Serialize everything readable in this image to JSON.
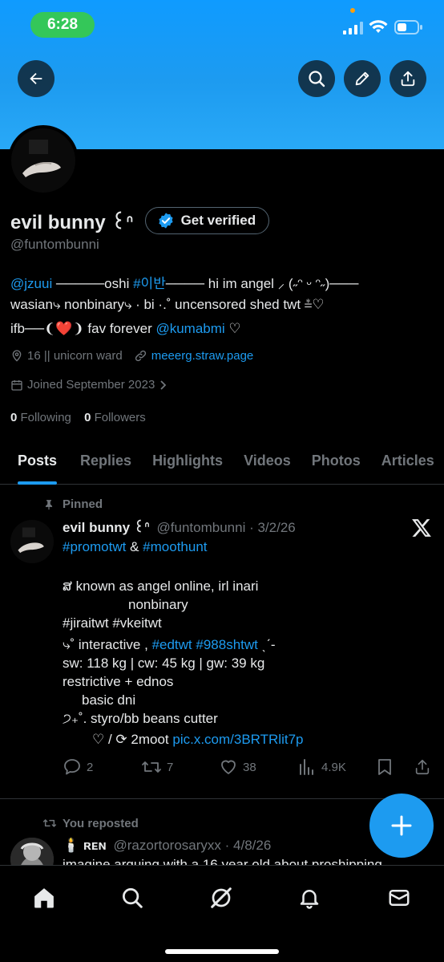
{
  "status_bar": {
    "time": "6:28"
  },
  "profile": {
    "display_name": "evil bunny ૮⁀⁀⁀",
    "display_name_short": "evil bunny ꒰ᐢ",
    "get_verified": "Get verified",
    "handle": "@funtombunni",
    "bio": {
      "line1": {
        "mention1": "@jzuui",
        "t1": " ─────oshi ",
        "hashtag": "#이반",
        "t2": "──── hi im angel ⸝ (˶ᵔ ᵕ ᵔ˶)───"
      },
      "line2": "wasian⤷ nonbinary⤷ · bi ·.˚ uncensored shed twt ⩮♡",
      "line3": {
        "t1": "ifb──❨❤️❩ fav forever ",
        "mention": "@kumabmi",
        "t2": " ♡"
      }
    },
    "location": "16 || unicorn ward",
    "website": "meeerg.straw.page",
    "joined": "Joined September 2023",
    "following_count": "0",
    "following_label": "Following",
    "followers_count": "0",
    "followers_label": "Followers"
  },
  "tabs": [
    "Posts",
    "Replies",
    "Highlights",
    "Videos",
    "Photos",
    "Articles"
  ],
  "pinned_post": {
    "pinned_label": "Pinned",
    "author_name": "evil bunny ꒰ᐢ",
    "author_handle": "@funtombunni",
    "date": "· 3/2/26",
    "line1": {
      "hashtag1": "#promotwt",
      "amp": " & ",
      "hashtag2": "#moothunt"
    },
    "line2": "ສ known as angel online, irl inari",
    "line3": "nonbinary",
    "line4": "#jiraitwt #vkeitwt",
    "line5": {
      "t1": "⤷˚   interactive , ",
      "hashtags": "#edtwt #988shtwt",
      "t2": " ˎˊ-"
    },
    "line6": " sw: 118 kg  |  cw: 45 kg | gw: 39 kg",
    "line7": " restrictive + ednos",
    "line8": "basic dni",
    "line9": "੭₊˚. styro/bb beans cutter",
    "line10": {
      "t1": "♡ / ⟳ 2moot ",
      "link": "pic.x.com/3BRTRlit7p"
    },
    "replies": "2",
    "reposts": "7",
    "likes": "38",
    "views": "4.9K"
  },
  "repost": {
    "label": "You reposted",
    "author_name": "🕯️ ʀᴇɴ",
    "author_handle": "@razortorosaryxx",
    "date": "· 4/8/26",
    "text": "imagine arguing with a 16 year old about proshipping"
  },
  "icons": {
    "back": "back-arrow-icon",
    "search": "search-icon",
    "edit": "pencil-icon",
    "share": "share-icon",
    "verified": "verified-badge-icon",
    "location": "location-icon",
    "link": "link-icon",
    "calendar": "calendar-icon",
    "pin": "pin-icon",
    "x_logo": "x-logo-icon",
    "reply": "reply-icon",
    "repost": "repost-icon",
    "like": "heart-icon",
    "views": "views-icon",
    "bookmark": "bookmark-icon",
    "compose": "plus-icon",
    "home": "home-icon",
    "explore": "search-icon",
    "grok": "grok-icon",
    "notifications": "bell-icon",
    "messages": "mail-icon"
  },
  "colors": {
    "accent": "#1d9bf0",
    "background": "#000000",
    "muted": "#71767b",
    "text": "#e7e9ea",
    "status_time_bg": "#34c759"
  }
}
